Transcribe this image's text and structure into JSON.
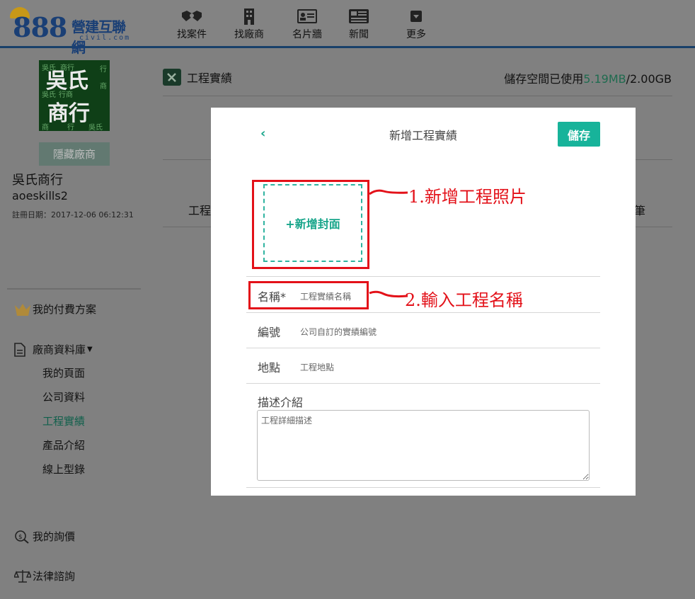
{
  "brand": {
    "number": "888",
    "cn": "營建互聯網",
    "en": "civil.com"
  },
  "nav": [
    {
      "label": "找案件",
      "icon": "handshake-icon"
    },
    {
      "label": "找廠商",
      "icon": "building-icon"
    },
    {
      "label": "名片牆",
      "icon": "id-card-icon"
    },
    {
      "label": "新聞",
      "icon": "newspaper-icon"
    },
    {
      "label": "更多",
      "icon": "dropdown-icon"
    }
  ],
  "company": {
    "avatar_text": "吳氏商行",
    "hide_label": "隱藏廠商",
    "name": "吳氏商行",
    "username": "aoeskills2",
    "registered": "註冊日期：2017-12-06 06:12:31"
  },
  "sidebar": {
    "plan": "我的付費方案",
    "database": "廠商資料庫",
    "sub_items": [
      "我的頁面",
      "公司資料",
      "工程實績",
      "產品介紹",
      "線上型錄"
    ],
    "active": "工程實績",
    "inquiry": "我的詢價",
    "legal": "法律諮詢"
  },
  "main": {
    "title": "工程實績",
    "storage_prefix": "儲存空間已使用",
    "storage_used": "5.19MB",
    "storage_total": "/2.00GB",
    "bg_col_left": "工程",
    "bg_col_right": "筆"
  },
  "modal": {
    "back": "‹",
    "title": "新增工程實績",
    "save": "儲存",
    "cover": "+新增封面",
    "fields": {
      "name_label": "名稱*",
      "name_placeholder": "工程實績名稱",
      "code_label": "編號",
      "code_placeholder": "公司自訂的實績編號",
      "location_label": "地點",
      "location_placeholder": "工程地點",
      "desc_label": "描述介紹",
      "desc_placeholder": "工程詳細描述"
    }
  },
  "annotations": {
    "step1": "1.新增工程照片",
    "step2": "2.輸入工程名稱"
  },
  "colors": {
    "accent": "#17b39a",
    "annotation": "#e31119",
    "nav_border": "#18406a"
  }
}
